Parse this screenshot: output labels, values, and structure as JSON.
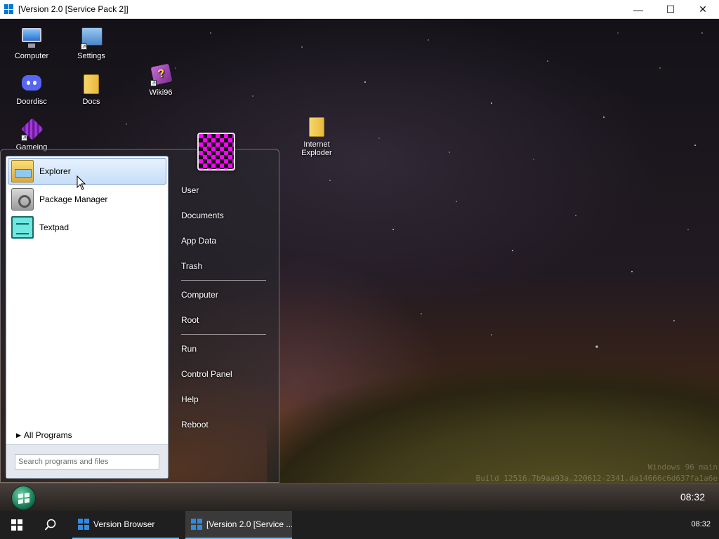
{
  "window": {
    "title": "[Version 2.0 [Service Pack 2]]",
    "controls": {
      "minimize": "—",
      "maximize": "☐",
      "close": "✕"
    }
  },
  "desktop": {
    "icons": [
      {
        "label": "Computer",
        "icon": "computer-icon"
      },
      {
        "label": "Settings",
        "icon": "settings-icon"
      },
      {
        "label": "Doordisc",
        "icon": "discord-icon"
      },
      {
        "label": "Docs",
        "icon": "folder-icon"
      },
      {
        "label": "Wiki96",
        "icon": "book-icon"
      },
      {
        "label": "Gameing",
        "icon": "cube-icon"
      },
      {
        "label": "Internet Exploder",
        "icon": "folder-icon"
      }
    ],
    "watermark": {
      "line1": "Windows 96 main",
      "line2": "Build 12516.7b9aa93a.220612-2341.da14666c6d637fa1a6e"
    }
  },
  "start_menu": {
    "apps": [
      {
        "label": "Explorer",
        "icon": "explorer-icon"
      },
      {
        "label": "Package Manager",
        "icon": "package-icon"
      },
      {
        "label": "Textpad",
        "icon": "textpad-icon"
      }
    ],
    "all_programs": "All Programs",
    "search_placeholder": "Search programs and files",
    "places": [
      "User",
      "Documents",
      "App Data",
      "Trash",
      "Computer",
      "Root",
      "Run",
      "Control Panel",
      "Help",
      "Reboot"
    ]
  },
  "guest_taskbar": {
    "clock": "08:32"
  },
  "host_taskbar": {
    "items": [
      {
        "label": "Version Browser"
      },
      {
        "label": "[Version 2.0 [Service ..."
      }
    ],
    "clock": "08:32"
  },
  "colors": {
    "accent": "#0078d7",
    "start_hover": "#c6def8",
    "user_pic_primary": "#ff00ff"
  }
}
